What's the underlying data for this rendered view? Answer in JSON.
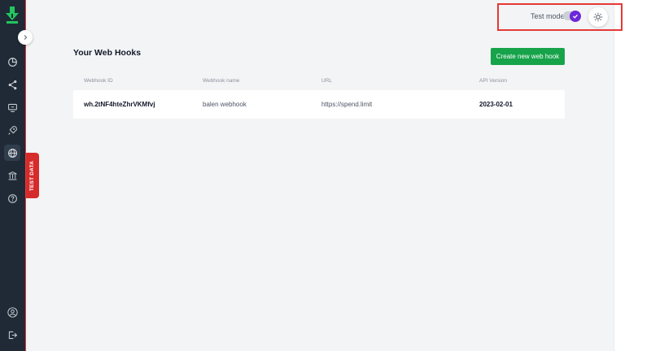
{
  "sidebar": {
    "nav": [
      {
        "icon": "pie-chart-icon"
      },
      {
        "icon": "share-icon"
      },
      {
        "icon": "monitor-icon"
      },
      {
        "icon": "rocket-icon"
      },
      {
        "icon": "globe-icon",
        "active": true
      },
      {
        "icon": "bank-icon"
      },
      {
        "icon": "help-icon"
      }
    ],
    "bottom": [
      {
        "icon": "user-icon"
      },
      {
        "icon": "logout-icon"
      }
    ],
    "test_data_label": "TEST DATA"
  },
  "header": {
    "test_mode_label": "Test mode",
    "test_mode_enabled": true
  },
  "main": {
    "title": "Your Web Hooks",
    "create_button_label": "Create new web hook",
    "table": {
      "columns": [
        "Webhook ID",
        "Webhook name",
        "URL",
        "API Version"
      ],
      "rows": [
        {
          "id": "wh.2tNF4hteZhrVKMfvj",
          "name": "balen webhook",
          "url": "https://spend.limit",
          "api_version": "2023-02-01"
        }
      ]
    }
  },
  "colors": {
    "sidebar_bg": "#1f2a36",
    "accent_green": "#16a34a",
    "toggle_purple": "#6d28d9",
    "test_data_red": "#d62b2b",
    "highlight_red": "#e53935"
  }
}
